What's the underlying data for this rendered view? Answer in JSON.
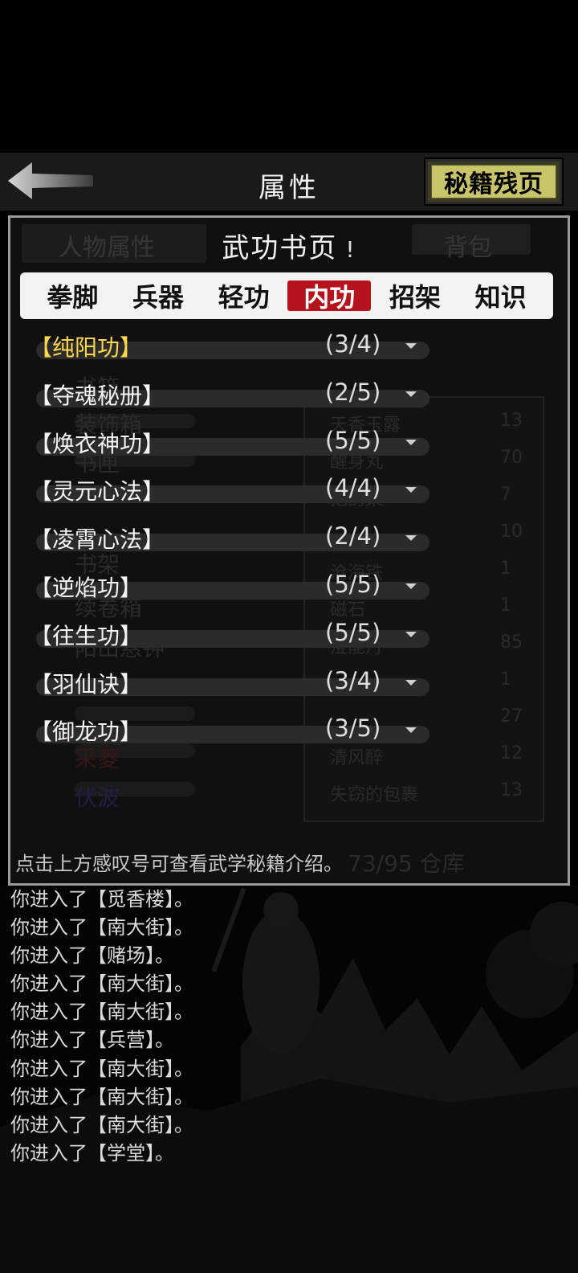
{
  "header": {
    "title": "属性",
    "right_button_label": "秘籍残页",
    "back_icon": "back-arrow-icon"
  },
  "background_screen": {
    "left_tab": "人物属性",
    "right_tab": "背包",
    "left_items": [
      "书箱",
      "装饰箱",
      "书匣",
      "书架",
      "续卷箱",
      "阳山悬钟",
      "采菱",
      "伏波"
    ],
    "right_items": [
      "天香玉露",
      "醒身丸",
      "抱韵梁",
      "沧海铁",
      "磁石",
      "澄能丹",
      "清风醉",
      "失窃的包裹"
    ],
    "right_counts": [
      "13",
      "70",
      "7",
      "10",
      "1",
      "1",
      "85",
      "1",
      "27",
      "12",
      "13"
    ],
    "capacity": "73/95 仓库"
  },
  "popup": {
    "title": "武功书页",
    "info_icon": "!",
    "tabs": [
      {
        "label": "拳脚",
        "active": false
      },
      {
        "label": "兵器",
        "active": false
      },
      {
        "label": "轻功",
        "active": false
      },
      {
        "label": "内功",
        "active": true
      },
      {
        "label": "招架",
        "active": false
      },
      {
        "label": "知识",
        "active": false
      }
    ],
    "skills": [
      {
        "name": "【纯阳功】",
        "progress": "(3/4)",
        "highlight": true
      },
      {
        "name": "【夺魂秘册】",
        "progress": "(2/5)",
        "highlight": false
      },
      {
        "name": "【焕衣神功】",
        "progress": "(5/5)",
        "highlight": false
      },
      {
        "name": "【灵元心法】",
        "progress": "(4/4)",
        "highlight": false
      },
      {
        "name": "【凌霄心法】",
        "progress": "(2/4)",
        "highlight": false
      },
      {
        "name": "【逆焰功】",
        "progress": "(5/5)",
        "highlight": false
      },
      {
        "name": "【往生功】",
        "progress": "(5/5)",
        "highlight": false
      },
      {
        "name": "【羽仙诀】",
        "progress": "(3/4)",
        "highlight": false
      },
      {
        "name": "【御龙功】",
        "progress": "(3/5)",
        "highlight": false
      }
    ],
    "hint": "点击上方感叹号可查看武学秘籍介绍。"
  },
  "log": [
    "你进入了【觅香楼】。",
    "你进入了【南大街】。",
    "你进入了【赌场】。",
    "你进入了【南大街】。",
    "你进入了【南大街】。",
    "你进入了【兵营】。",
    "你进入了【南大街】。",
    "你进入了【南大街】。",
    "你进入了【南大街】。",
    "你进入了【学堂】。"
  ],
  "colors": {
    "active_tab": "#b5141c",
    "highlight_skill": "#ffd84a",
    "header_button": "#c8c46a"
  }
}
